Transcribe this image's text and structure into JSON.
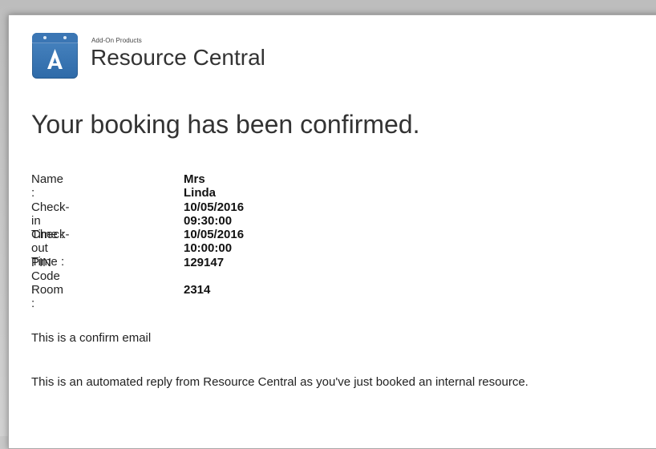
{
  "brand": {
    "small_label": "Add-On Products",
    "name": "Resource Central",
    "logo_icon": "resource-central-logo-icon",
    "logo_color": "#3a78b8"
  },
  "heading": "Your booking has been confirmed.",
  "details": [
    {
      "label": "Name :",
      "value": "Mrs Linda"
    },
    {
      "label": "Check-in Time :",
      "value": "10/05/2016 09:30:00"
    },
    {
      "label": "Check-out Time :",
      "value": "10/05/2016 10:00:00"
    },
    {
      "label": "PIN Code :",
      "value": "129147"
    },
    {
      "label": "Room :",
      "value": "2314"
    }
  ],
  "notes": {
    "confirm": "This is a confirm email",
    "automated": "This is an automated reply from Resource Central as you've just booked an internal resource."
  }
}
